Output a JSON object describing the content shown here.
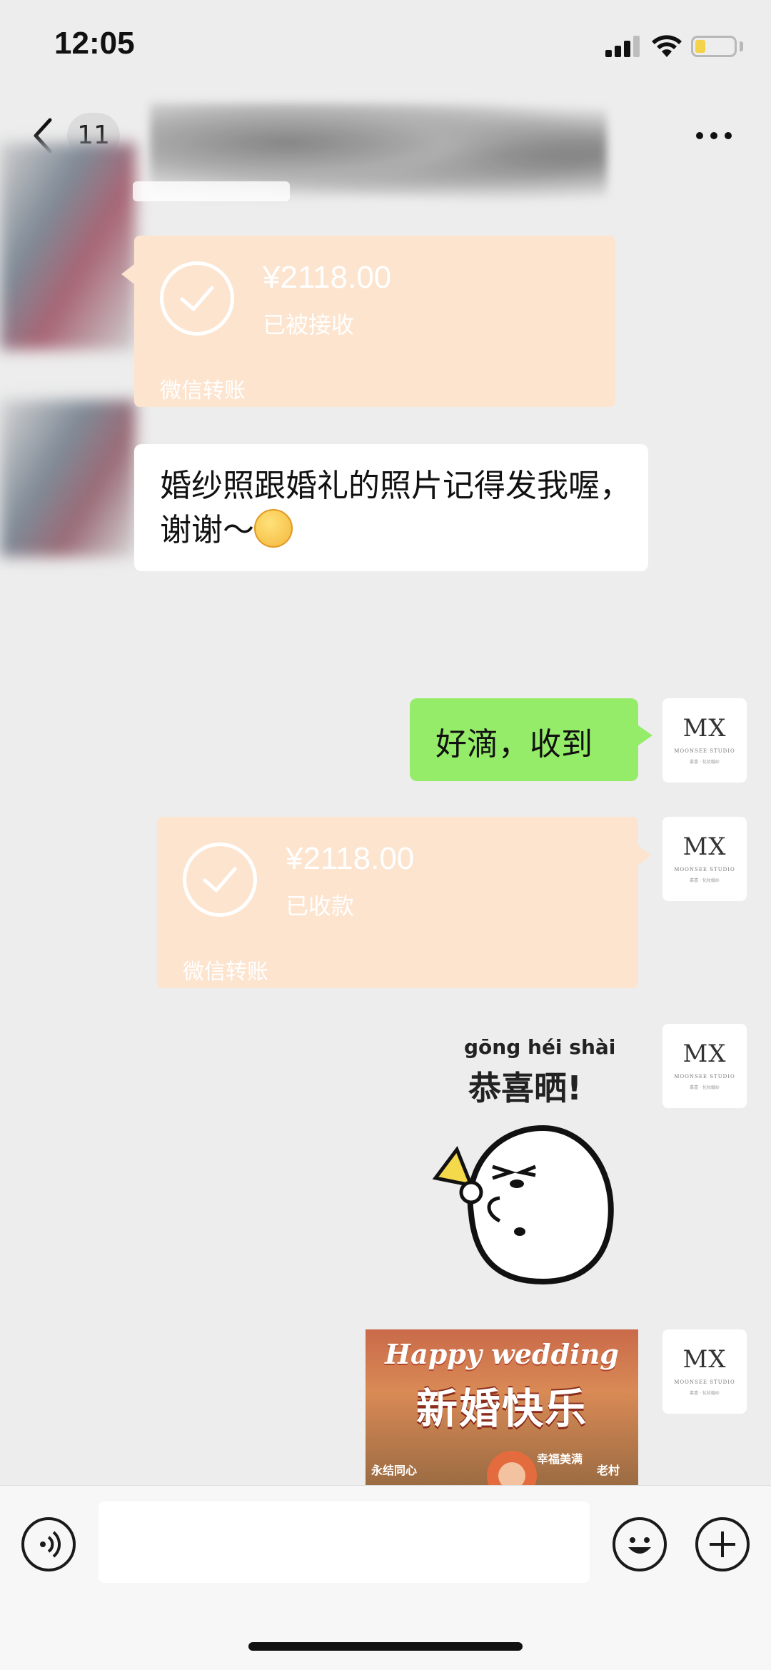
{
  "status_bar": {
    "time": "12:05"
  },
  "nav": {
    "back_count": "11"
  },
  "messages": {
    "incoming_transfer": {
      "amount": "¥2118.00",
      "status": "已被接收",
      "footer": "微信转账"
    },
    "incoming_text": {
      "text": "婚纱照跟婚礼的照片记得发我喔，谢谢～"
    },
    "outgoing_text": {
      "text": "好滴，收到"
    },
    "outgoing_transfer": {
      "amount": "¥2118.00",
      "status": "已收款",
      "footer": "微信转账"
    },
    "sticker": {
      "pinyin": "gōng héi shài",
      "text": "恭喜晒!"
    },
    "wedding_image": {
      "title_en": "Happy wedding",
      "title_cn": "新婚快乐",
      "caption_left": "永结同心",
      "caption_mid": "幸福美满",
      "caption_right": "老村"
    }
  },
  "studio_avatar": {
    "mark": "MX",
    "name": "MOONSEE STUDIO",
    "sub": "慕喜 · 化妆婚纱"
  },
  "colors": {
    "transfer_bg": "#fde4cf",
    "outgoing_bubble": "#95ec69",
    "chat_bg": "#ededed"
  }
}
